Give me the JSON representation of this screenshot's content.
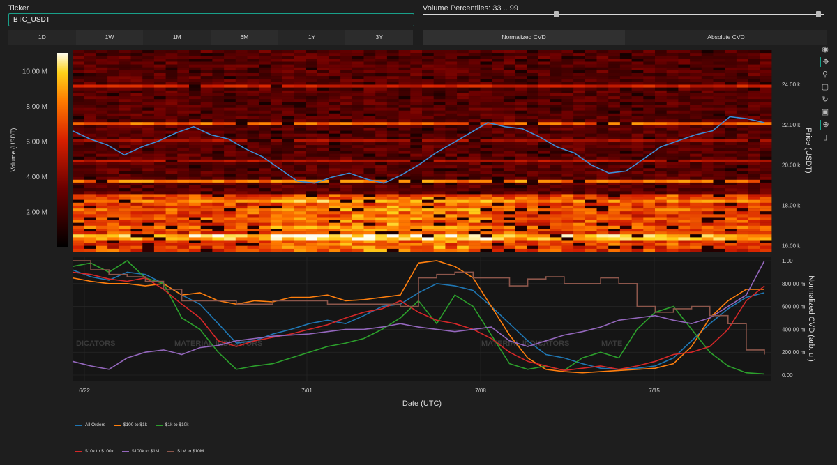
{
  "controls": {
    "ticker_label": "Ticker",
    "ticker_value": "BTC_USDT",
    "percentile_label": "Volume Percentiles: 33 .. 99",
    "slider_low": 33,
    "slider_high": 99,
    "timeframes": [
      "1D",
      "1W",
      "1M",
      "6M",
      "1Y",
      "3Y"
    ],
    "cvd_modes": [
      "Normalized CVD",
      "Absolute CVD"
    ],
    "cvd_selected": "Normalized CVD"
  },
  "toolbar": [
    "color-wheel-icon",
    "pan-icon",
    "zoom-in-icon",
    "zoom-box-icon",
    "reset-icon",
    "save-icon",
    "crosshair-icon",
    "comment-icon"
  ],
  "chart_data": [
    {
      "type": "heatmap",
      "title": "",
      "colorbar_label": "Volume (USDT)",
      "colorbar_ticks": [
        "2.00 M",
        "4.00 M",
        "6.00 M",
        "8.00 M",
        "10.00 M"
      ],
      "colorbar_range": [
        0,
        11000000
      ],
      "ylabel": "Price (USDT)",
      "yticks": [
        "16.00 k",
        "18.00 k",
        "20.00 k",
        "22.00 k",
        "24.00 k"
      ],
      "ylim": [
        15700,
        25700
      ],
      "price_series_name": "Price",
      "price_points": [
        [
          0,
          21.7
        ],
        [
          1,
          21.3
        ],
        [
          2,
          21.0
        ],
        [
          3,
          20.5
        ],
        [
          4,
          20.9
        ],
        [
          5,
          21.2
        ],
        [
          6,
          21.6
        ],
        [
          7,
          21.9
        ],
        [
          8,
          21.5
        ],
        [
          9,
          21.3
        ],
        [
          10,
          20.8
        ],
        [
          11,
          20.4
        ],
        [
          12,
          19.8
        ],
        [
          13,
          19.2
        ],
        [
          14,
          19.1
        ],
        [
          15,
          19.4
        ],
        [
          16,
          19.6
        ],
        [
          17,
          19.3
        ],
        [
          18,
          19.1
        ],
        [
          19,
          19.5
        ],
        [
          20,
          20.0
        ],
        [
          21,
          20.6
        ],
        [
          22,
          21.1
        ],
        [
          23,
          21.6
        ],
        [
          24,
          22.1
        ],
        [
          25,
          21.9
        ],
        [
          26,
          21.8
        ],
        [
          27,
          21.4
        ],
        [
          28,
          20.9
        ],
        [
          29,
          20.6
        ],
        [
          30,
          20.0
        ],
        [
          31,
          19.6
        ],
        [
          32,
          19.7
        ],
        [
          33,
          20.3
        ],
        [
          34,
          20.9
        ],
        [
          35,
          21.2
        ],
        [
          36,
          21.5
        ],
        [
          37,
          21.7
        ],
        [
          38,
          22.4
        ],
        [
          39,
          22.3
        ],
        [
          40,
          22.1
        ]
      ]
    },
    {
      "type": "line",
      "title": "",
      "xlabel": "Date (UTC)",
      "ylabel": "Normalized CVD (arb. u.)",
      "yticks": [
        "0.00",
        "200.00 m",
        "400.00 m",
        "600.00 m",
        "800.00 m",
        "1.00"
      ],
      "ylim": [
        0,
        1
      ],
      "xticks": [
        "6/22",
        "7/01",
        "7/08",
        "7/15"
      ],
      "watermark": [
        "DICATORS",
        "MATERIAL INDICATORS",
        "MATERIAL INDICATORS",
        "MATE"
      ],
      "series": [
        {
          "name": "All Orders",
          "color": "#1f77b4",
          "values": [
            0.92,
            0.86,
            0.83,
            0.9,
            0.88,
            0.8,
            0.7,
            0.62,
            0.45,
            0.28,
            0.3,
            0.36,
            0.4,
            0.45,
            0.48,
            0.45,
            0.52,
            0.6,
            0.62,
            0.72,
            0.8,
            0.78,
            0.74,
            0.6,
            0.45,
            0.3,
            0.18,
            0.15,
            0.1,
            0.06,
            0.05,
            0.06,
            0.08,
            0.15,
            0.3,
            0.45,
            0.58,
            0.68,
            0.72
          ]
        },
        {
          "name": "$100 to $1k",
          "color": "#ff7f0e",
          "values": [
            0.85,
            0.82,
            0.8,
            0.8,
            0.78,
            0.8,
            0.7,
            0.72,
            0.65,
            0.62,
            0.65,
            0.64,
            0.68,
            0.68,
            0.7,
            0.65,
            0.66,
            0.68,
            0.7,
            0.98,
            1.0,
            0.95,
            0.85,
            0.6,
            0.35,
            0.15,
            0.05,
            0.03,
            0.02,
            0.03,
            0.04,
            0.05,
            0.06,
            0.1,
            0.25,
            0.5,
            0.65,
            0.75,
            0.75
          ]
        },
        {
          "name": "$1k to $10k",
          "color": "#2ca02c",
          "values": [
            0.95,
            0.98,
            0.9,
            1.0,
            0.85,
            0.8,
            0.5,
            0.4,
            0.2,
            0.05,
            0.08,
            0.1,
            0.15,
            0.2,
            0.25,
            0.28,
            0.32,
            0.4,
            0.5,
            0.65,
            0.45,
            0.7,
            0.6,
            0.35,
            0.1,
            0.05,
            0.08,
            0.04,
            0.15,
            0.2,
            0.15,
            0.4,
            0.55,
            0.6,
            0.4,
            0.2,
            0.08,
            0.02,
            0.01
          ]
        },
        {
          "name": "$10k to $100k",
          "color": "#d62728",
          "values": [
            0.9,
            0.88,
            0.84,
            0.82,
            0.85,
            0.75,
            0.62,
            0.5,
            0.3,
            0.25,
            0.3,
            0.33,
            0.36,
            0.4,
            0.44,
            0.5,
            0.55,
            0.58,
            0.65,
            0.55,
            0.48,
            0.45,
            0.4,
            0.32,
            0.2,
            0.12,
            0.08,
            0.04,
            0.06,
            0.08,
            0.05,
            0.08,
            0.12,
            0.18,
            0.2,
            0.25,
            0.4,
            0.65,
            0.78
          ]
        },
        {
          "name": "$100k to $1M",
          "color": "#9467bd",
          "values": [
            0.12,
            0.08,
            0.05,
            0.15,
            0.2,
            0.22,
            0.18,
            0.24,
            0.26,
            0.3,
            0.32,
            0.34,
            0.35,
            0.36,
            0.38,
            0.4,
            0.4,
            0.42,
            0.45,
            0.42,
            0.4,
            0.38,
            0.4,
            0.42,
            0.3,
            0.25,
            0.3,
            0.35,
            0.38,
            0.42,
            0.48,
            0.5,
            0.52,
            0.48,
            0.45,
            0.5,
            0.6,
            0.7,
            1.0
          ]
        },
        {
          "name": "$1M to $10M",
          "color": "#8c564b",
          "values": [
            1.0,
            0.92,
            0.88,
            0.86,
            0.82,
            0.75,
            0.65,
            0.65,
            0.65,
            0.62,
            0.62,
            0.65,
            0.65,
            0.65,
            0.62,
            0.62,
            0.62,
            0.62,
            0.6,
            0.85,
            0.88,
            0.9,
            0.85,
            0.85,
            0.78,
            0.84,
            0.86,
            0.8,
            0.8,
            0.85,
            0.8,
            0.6,
            0.55,
            0.58,
            0.6,
            0.52,
            0.45,
            0.22,
            0.18
          ]
        }
      ]
    }
  ]
}
